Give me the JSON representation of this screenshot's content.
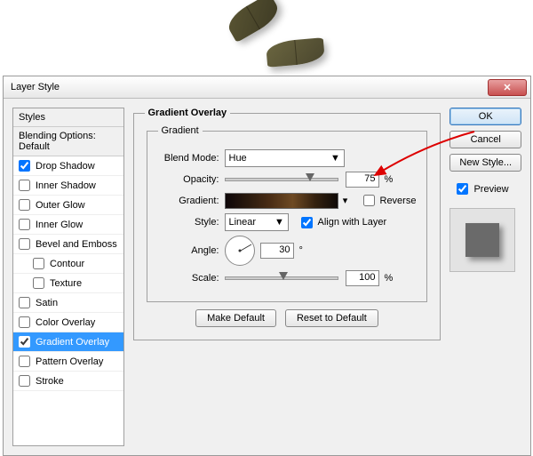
{
  "window": {
    "title": "Layer Style"
  },
  "sidebar": {
    "header": "Styles",
    "subheader": "Blending Options: Default",
    "items": [
      {
        "label": "Drop Shadow",
        "checked": true,
        "indent": false
      },
      {
        "label": "Inner Shadow",
        "checked": false,
        "indent": false
      },
      {
        "label": "Outer Glow",
        "checked": false,
        "indent": false
      },
      {
        "label": "Inner Glow",
        "checked": false,
        "indent": false
      },
      {
        "label": "Bevel and Emboss",
        "checked": false,
        "indent": false
      },
      {
        "label": "Contour",
        "checked": false,
        "indent": true
      },
      {
        "label": "Texture",
        "checked": false,
        "indent": true
      },
      {
        "label": "Satin",
        "checked": false,
        "indent": false
      },
      {
        "label": "Color Overlay",
        "checked": false,
        "indent": false
      },
      {
        "label": "Gradient Overlay",
        "checked": true,
        "indent": false,
        "selected": true
      },
      {
        "label": "Pattern Overlay",
        "checked": false,
        "indent": false
      },
      {
        "label": "Stroke",
        "checked": false,
        "indent": false
      }
    ]
  },
  "panel": {
    "title": "Gradient Overlay",
    "group": "Gradient",
    "labels": {
      "blend_mode": "Blend Mode:",
      "opacity": "Opacity:",
      "gradient": "Gradient:",
      "style": "Style:",
      "angle": "Angle:",
      "scale": "Scale:",
      "reverse": "Reverse",
      "align": "Align with Layer",
      "make_default": "Make Default",
      "reset_default": "Reset to Default",
      "pct": "%",
      "deg": "°"
    },
    "values": {
      "blend_mode": "Hue",
      "opacity": "75",
      "style": "Linear",
      "reverse": false,
      "align": true,
      "angle": "30",
      "scale": "100"
    }
  },
  "buttons": {
    "ok": "OK",
    "cancel": "Cancel",
    "new_style": "New Style...",
    "preview": "Preview"
  }
}
